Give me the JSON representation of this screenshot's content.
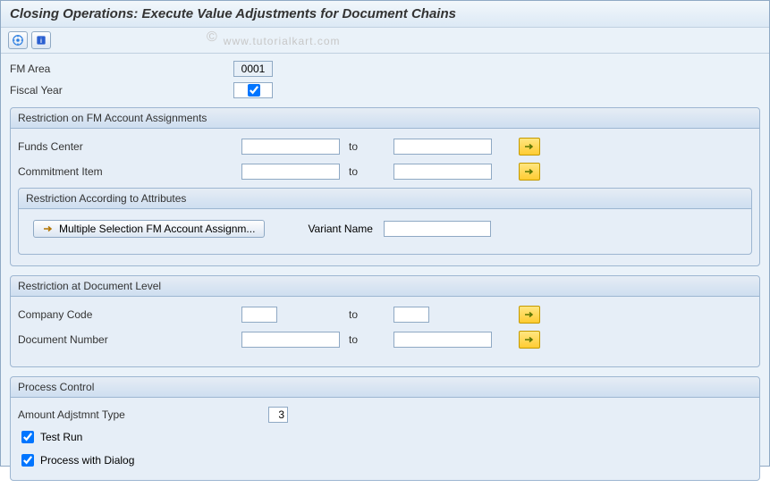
{
  "title": "Closing Operations: Execute Value Adjustments for Document Chains",
  "watermark": "www.tutorialkart.com",
  "header": {
    "fm_area_label": "FM Area",
    "fm_area_value": "0001",
    "fiscal_year_label": "Fiscal Year",
    "fiscal_year_checked": true
  },
  "group_fm": {
    "title": "Restriction on FM Account Assignments",
    "funds_center_label": "Funds Center",
    "commitment_item_label": "Commitment Item",
    "to_label": "to",
    "sub_title": "Restriction According to Attributes",
    "multi_sel_label": "Multiple Selection FM Account Assignm...",
    "variant_name_label": "Variant Name",
    "variant_name_value": ""
  },
  "group_doc": {
    "title": "Restriction at Document Level",
    "company_code_label": "Company Code",
    "doc_number_label": "Document Number",
    "to_label": "to"
  },
  "group_proc": {
    "title": "Process Control",
    "amount_type_label": "Amount Adjstmnt Type",
    "amount_type_value": "3",
    "test_run_label": "Test Run",
    "test_run_checked": true,
    "dialog_label": "Process with Dialog",
    "dialog_checked": true
  }
}
